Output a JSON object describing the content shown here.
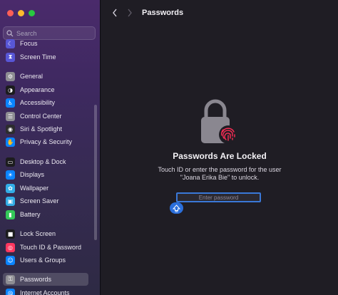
{
  "sidebar": {
    "search_placeholder": "Search",
    "items": [
      {
        "label": "Focus",
        "icon": "moon-icon",
        "color": "#5856d6"
      },
      {
        "label": "Screen Time",
        "icon": "hourglass-icon",
        "color": "#5856d6"
      },
      {
        "label": "General",
        "icon": "gear-icon",
        "color": "#8e8e93"
      },
      {
        "label": "Appearance",
        "icon": "appearance-icon",
        "color": "#1c1c1e"
      },
      {
        "label": "Accessibility",
        "icon": "accessibility-icon",
        "color": "#0a84ff"
      },
      {
        "label": "Control Center",
        "icon": "control-center-icon",
        "color": "#8e8e93"
      },
      {
        "label": "Siri & Spotlight",
        "icon": "siri-icon",
        "color": "#2c2c2e"
      },
      {
        "label": "Privacy & Security",
        "icon": "hand-icon",
        "color": "#0a84ff"
      },
      {
        "label": "Desktop & Dock",
        "icon": "dock-icon",
        "color": "#1c1c1e"
      },
      {
        "label": "Displays",
        "icon": "sun-icon",
        "color": "#0a84ff"
      },
      {
        "label": "Wallpaper",
        "icon": "wallpaper-icon",
        "color": "#32ade6"
      },
      {
        "label": "Screen Saver",
        "icon": "screen-saver-icon",
        "color": "#32ade6"
      },
      {
        "label": "Battery",
        "icon": "battery-icon",
        "color": "#34c759"
      },
      {
        "label": "Lock Screen",
        "icon": "lock-screen-icon",
        "color": "#1c1c1e"
      },
      {
        "label": "Touch ID & Password",
        "icon": "fingerprint-icon",
        "color": "#ff375f"
      },
      {
        "label": "Users & Groups",
        "icon": "users-icon",
        "color": "#0a84ff"
      },
      {
        "label": "Passwords",
        "icon": "key-icon",
        "color": "#8e8e93"
      },
      {
        "label": "Internet Accounts",
        "icon": "at-icon",
        "color": "#0a84ff"
      }
    ],
    "selected": "Passwords"
  },
  "header": {
    "title": "Passwords",
    "back_icon": "chevron-left-icon",
    "forward_icon": "chevron-right-icon"
  },
  "main": {
    "locked_title": "Passwords Are Locked",
    "locked_line1": "Touch ID or enter the password for the user",
    "locked_line2": "\"Joana Erika Bie\" to unlock.",
    "password_placeholder": "Enter password",
    "lock_icon": "lock-fingerprint-icon",
    "shift_icon": "caps-lock-icon"
  },
  "colors": {
    "accent": "#2b6fdb",
    "fingerprint": "#ff2d55"
  }
}
